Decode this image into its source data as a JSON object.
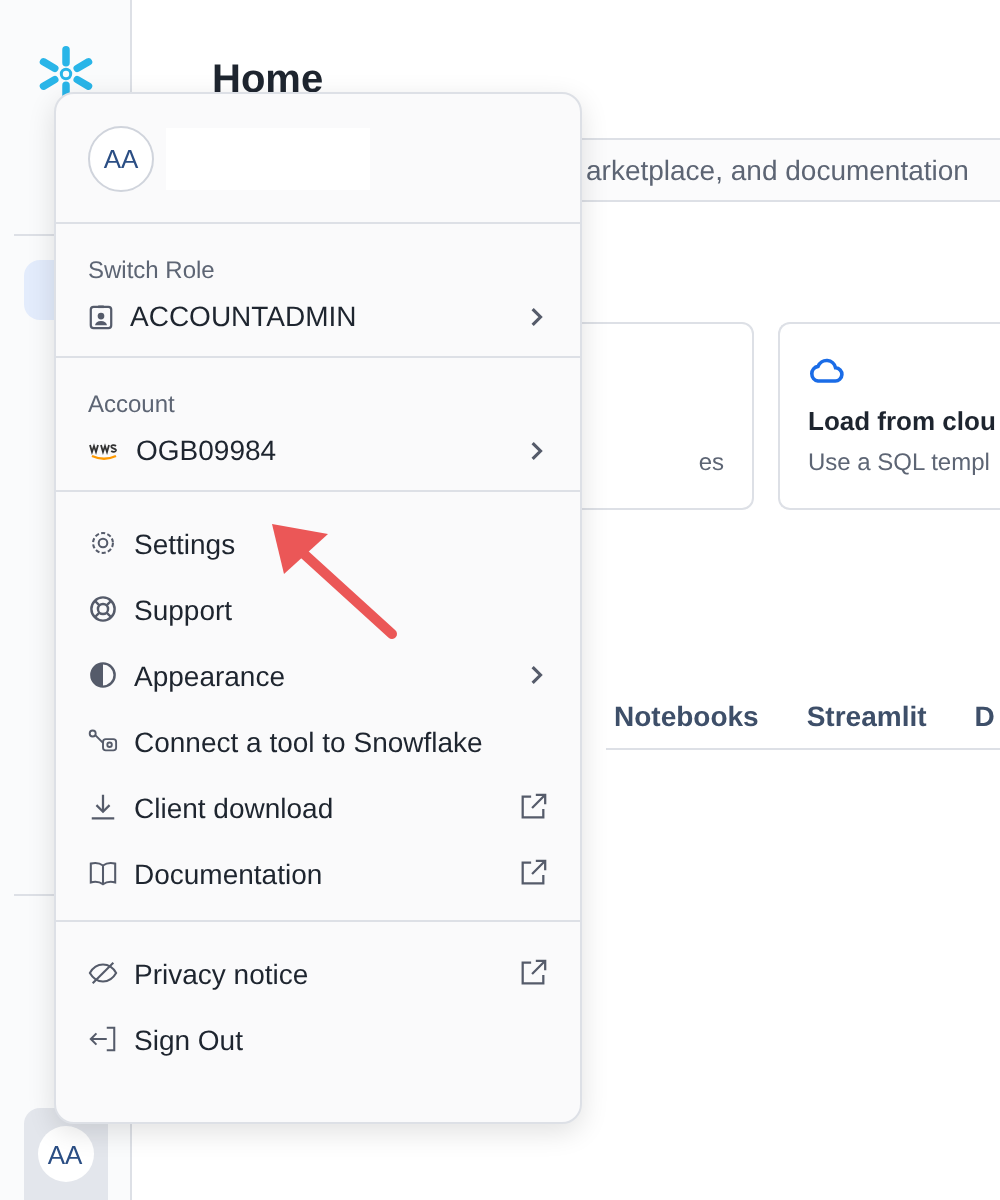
{
  "sidebar": {
    "initials": "AA"
  },
  "page": {
    "title": "Home",
    "search": {
      "placeholder": "arketplace, and documentation"
    },
    "cards": [
      {
        "description": "es"
      },
      {
        "title": "Load from clou",
        "description": "Use a SQL templ"
      }
    ],
    "tabs": [
      {
        "label": "Notebooks"
      },
      {
        "label": "Streamlit"
      },
      {
        "label": "D"
      }
    ]
  },
  "user_menu": {
    "initials": "AA",
    "contexts": [
      {
        "label": "Switch Role",
        "value": "ACCOUNTADMIN"
      },
      {
        "label": "Account",
        "value": "OGB09984"
      }
    ],
    "groups": [
      [
        {
          "label": "Settings",
          "submenu": false,
          "external": false
        },
        {
          "label": "Support",
          "submenu": false,
          "external": false
        },
        {
          "label": "Appearance",
          "submenu": true,
          "external": false
        },
        {
          "label": "Connect a tool to Snowflake",
          "submenu": false,
          "external": false
        },
        {
          "label": "Client download",
          "submenu": false,
          "external": true
        },
        {
          "label": "Documentation",
          "submenu": false,
          "external": true
        }
      ],
      [
        {
          "label": "Privacy notice",
          "submenu": false,
          "external": true
        },
        {
          "label": "Sign Out",
          "submenu": false,
          "external": false
        }
      ]
    ]
  }
}
